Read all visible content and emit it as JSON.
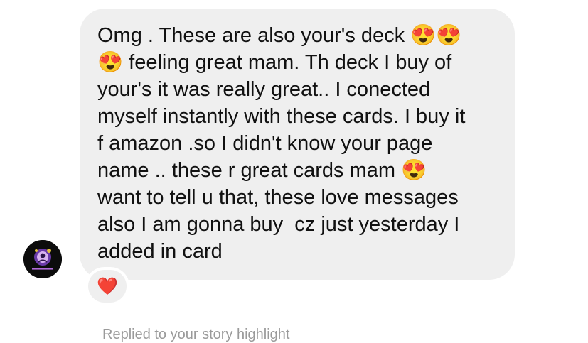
{
  "thread": {
    "sender_avatar": "profile-avatar",
    "message": {
      "lines": [
        "Omg . These are also your's deck 😍😍",
        "😍 feeling great mam. Th deck I buy of",
        "your's it was really great.. I conected",
        "myself instantly with these cards. I buy it",
        "f amazon .so I didn't know your page",
        "name .. these r great cards mam 😍",
        "want to tell u that, these love messages",
        "also I am gonna buy  cz just yesterday I",
        "added in card"
      ]
    },
    "reaction": {
      "emoji": "❤️",
      "icon": "red-heart-icon"
    },
    "reply_note": "Replied to your story highlight"
  },
  "colors": {
    "bubble": "#efefef",
    "text": "#111111",
    "heart": "#e0245e",
    "muted_text": "#9a9a9a"
  }
}
